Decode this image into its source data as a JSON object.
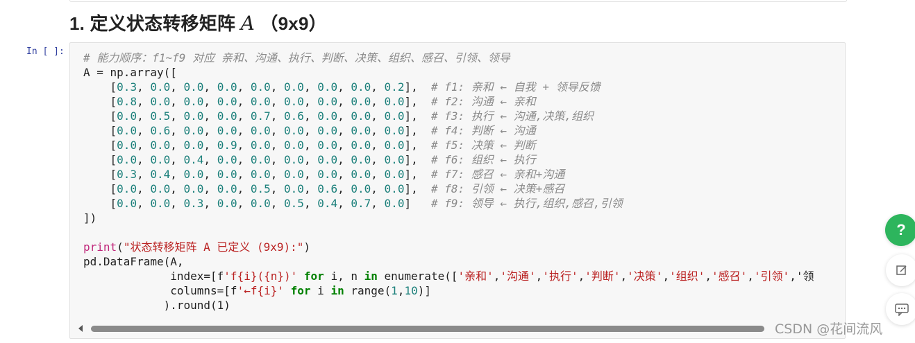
{
  "heading": {
    "number": "1.",
    "text": "定义状态转移矩阵",
    "math": "A",
    "size": "（9x9）"
  },
  "cell": {
    "prompt": "In [ ]:",
    "comment_order": "# 能力顺序：f1~f9 对应 亲和、沟通、执行、判断、决策、组织、感召、引领、领导",
    "array_open": "A = np.array([",
    "rows": [
      {
        "values": "[0.3, 0.0, 0.0, 0.0, 0.0, 0.0, 0.0, 0.0, 0.2],",
        "comment": "# f1: 亲和 ← 自我 + 领导反馈"
      },
      {
        "values": "[0.8, 0.0, 0.0, 0.0, 0.0, 0.0, 0.0, 0.0, 0.0],",
        "comment": "# f2: 沟通 ← 亲和"
      },
      {
        "values": "[0.0, 0.5, 0.0, 0.0, 0.7, 0.6, 0.0, 0.0, 0.0],",
        "comment": "# f3: 执行 ← 沟通,决策,组织"
      },
      {
        "values": "[0.0, 0.6, 0.0, 0.0, 0.0, 0.0, 0.0, 0.0, 0.0],",
        "comment": "# f4: 判断 ← 沟通"
      },
      {
        "values": "[0.0, 0.0, 0.0, 0.9, 0.0, 0.0, 0.0, 0.0, 0.0],",
        "comment": "# f5: 决策 ← 判断"
      },
      {
        "values": "[0.0, 0.0, 0.4, 0.0, 0.0, 0.0, 0.0, 0.0, 0.0],",
        "comment": "# f6: 组织 ← 执行"
      },
      {
        "values": "[0.3, 0.4, 0.0, 0.0, 0.0, 0.0, 0.0, 0.0, 0.0],",
        "comment": "# f7: 感召 ← 亲和+沟通"
      },
      {
        "values": "[0.0, 0.0, 0.0, 0.0, 0.5, 0.0, 0.6, 0.0, 0.0],",
        "comment": "# f8: 引领 ← 决策+感召"
      },
      {
        "values": "[0.0, 0.0, 0.3, 0.0, 0.0, 0.5, 0.4, 0.7, 0.0] ",
        "comment": "# f9: 领导 ← 执行,组织,感召,引领"
      }
    ],
    "array_close": "])",
    "print_func": "print",
    "print_arg": "\"状态转移矩阵 A 已定义 (9x9):\"",
    "df_open": "pd.DataFrame(A,",
    "index_line": "index=[f'f{i}({n})' for i, n in enumerate(['亲和','沟通','执行','判断','决策','组织','感召','引领','领",
    "columns_line": "columns=[f'←f{i}' for i in range(1,10)]",
    "round_line": ").round(1)"
  },
  "fabs": {
    "help": "?",
    "edit_icon": "edit-icon",
    "message_icon": "message-icon"
  },
  "watermark": "CSDN @花间流风"
}
